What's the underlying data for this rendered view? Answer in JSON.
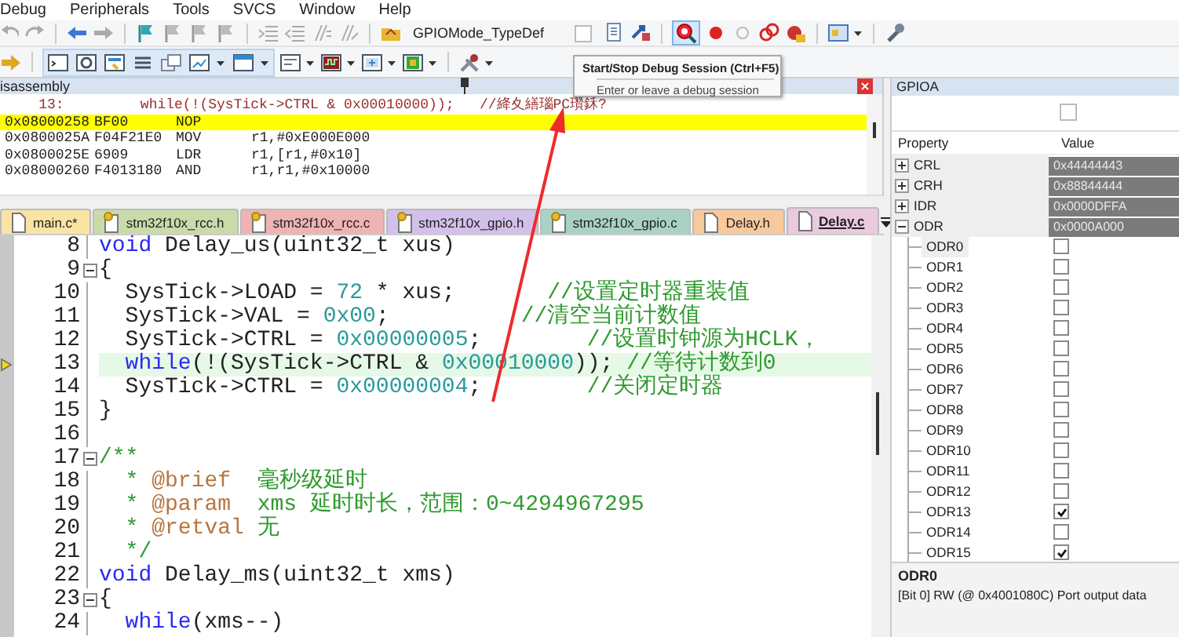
{
  "menu": [
    "Debug",
    "Peripherals",
    "Tools",
    "SVCS",
    "Window",
    "Help"
  ],
  "toolbar": {
    "symbol": "GPIOMode_TypeDef",
    "debug_button_highlighted": true
  },
  "tooltip": {
    "title": "Start/Stop Debug Session (Ctrl+F5)",
    "description": "Enter or leave a debug session"
  },
  "disassembly": {
    "title": "isassembly",
    "source": {
      "line": "13:",
      "code": "while(!(SysTick->CTRL & 0x00010000));   //絳夊繕瑙PC瓚鉌?"
    },
    "rows": [
      {
        "address": "0x08000258",
        "opcode": "BF00",
        "mnemonic": "NOP",
        "selected": true
      },
      {
        "address": "0x0800025A",
        "opcode": "F04F21E0",
        "mnemonic": "MOV",
        "operands": "r1,#0xE000E000",
        "selected": false
      },
      {
        "address": "0x0800025E",
        "opcode": "6909",
        "mnemonic": "LDR",
        "operands": "r1,[r1,#0x10]",
        "selected": false
      },
      {
        "address": "0x08000260",
        "opcode": "F4013180",
        "mnemonic": "AND",
        "operands": "r1,r1,#0x10000",
        "selected": false
      }
    ]
  },
  "editor": {
    "tabs": [
      {
        "label": "main.c*",
        "kind": "user",
        "color": "#f9e4a4",
        "selected": false
      },
      {
        "label": "stm32f10x_rcc.h",
        "kind": "library",
        "color": "#c9dba9",
        "selected": false
      },
      {
        "label": "stm32f10x_rcc.c",
        "kind": "library",
        "color": "#f0b3b3",
        "selected": false
      },
      {
        "label": "stm32f10x_gpio.h",
        "kind": "library",
        "color": "#d3c0ea",
        "selected": false
      },
      {
        "label": "stm32f10x_gpio.c",
        "kind": "library",
        "color": "#a9d2c5",
        "selected": false
      },
      {
        "label": "Delay.h",
        "kind": "user",
        "color": "#f7c99c",
        "selected": false
      },
      {
        "label": "Delay.c",
        "kind": "user",
        "color": "#e9cade",
        "selected": true
      }
    ],
    "lines": [
      {
        "number": "8",
        "fold": false,
        "current": false,
        "segments": [
          {
            "kind": "keyword",
            "text": "void"
          },
          {
            "kind": "plain",
            "text": " Delay_us(uint32_t xus)"
          }
        ]
      },
      {
        "number": "9",
        "fold": true,
        "current": false,
        "segments": [
          {
            "kind": "plain",
            "text": "{"
          }
        ]
      },
      {
        "number": "10",
        "fold": false,
        "current": false,
        "indented": true,
        "segments": [
          {
            "kind": "plain",
            "text": "SysTick->LOAD = "
          },
          {
            "kind": "number",
            "text": "72"
          },
          {
            "kind": "plain",
            "text": " * xus;       "
          },
          {
            "kind": "comment",
            "text": "//设置定时器重装值"
          }
        ]
      },
      {
        "number": "11",
        "fold": false,
        "current": false,
        "indented": true,
        "segments": [
          {
            "kind": "plain",
            "text": "SysTick->VAL = "
          },
          {
            "kind": "number",
            "text": "0x00"
          },
          {
            "kind": "plain",
            "text": ";          "
          },
          {
            "kind": "comment",
            "text": "//清空当前计数值"
          }
        ]
      },
      {
        "number": "12",
        "fold": false,
        "current": false,
        "indented": true,
        "segments": [
          {
            "kind": "plain",
            "text": "SysTick->CTRL = "
          },
          {
            "kind": "number",
            "text": "0x00000005"
          },
          {
            "kind": "plain",
            "text": ";        "
          },
          {
            "kind": "comment",
            "text": "//设置时钟源为HCLK，"
          }
        ]
      },
      {
        "number": "13",
        "fold": false,
        "current": true,
        "indented": true,
        "segments": [
          {
            "kind": "keyword",
            "text": "while"
          },
          {
            "kind": "plain",
            "text": "(!(SysTick->CTRL & "
          },
          {
            "kind": "number",
            "text": "0x00010000"
          },
          {
            "kind": "plain",
            "text": ")); "
          },
          {
            "kind": "comment",
            "text": "//等待计数到0"
          }
        ]
      },
      {
        "number": "14",
        "fold": false,
        "current": false,
        "indented": true,
        "segments": [
          {
            "kind": "plain",
            "text": "SysTick->CTRL = "
          },
          {
            "kind": "number",
            "text": "0x00000004"
          },
          {
            "kind": "plain",
            "text": ";        "
          },
          {
            "kind": "comment",
            "text": "//关闭定时器"
          }
        ]
      },
      {
        "number": "15",
        "fold": false,
        "current": false,
        "segments": [
          {
            "kind": "plain",
            "text": "}"
          }
        ]
      },
      {
        "number": "16",
        "fold": false,
        "current": false
      },
      {
        "number": "17",
        "fold": true,
        "current": false,
        "segments": [
          {
            "kind": "comment",
            "text": "/**"
          }
        ]
      },
      {
        "number": "18",
        "fold": false,
        "current": false,
        "indented": true,
        "segments": [
          {
            "kind": "comment",
            "text": "* "
          },
          {
            "kind": "tag",
            "text": "@brief"
          },
          {
            "kind": "comment",
            "text": "  毫秒级延时"
          }
        ]
      },
      {
        "number": "19",
        "fold": false,
        "current": false,
        "indented": true,
        "segments": [
          {
            "kind": "comment",
            "text": "* "
          },
          {
            "kind": "tag",
            "text": "@param"
          },
          {
            "kind": "comment",
            "text": "  xms 延时时长，范围：0~4294967295"
          }
        ]
      },
      {
        "number": "20",
        "fold": false,
        "current": false,
        "indented": true,
        "segments": [
          {
            "kind": "comment",
            "text": "* "
          },
          {
            "kind": "tag",
            "text": "@retval"
          },
          {
            "kind": "comment",
            "text": " 无"
          }
        ]
      },
      {
        "number": "21",
        "fold": false,
        "current": false,
        "indented": true,
        "segments": [
          {
            "kind": "comment",
            "text": "*/"
          }
        ]
      },
      {
        "number": "22",
        "fold": false,
        "current": false,
        "segments": [
          {
            "kind": "keyword",
            "text": "void"
          },
          {
            "kind": "plain",
            "text": " Delay_ms(uint32_t xms)"
          }
        ]
      },
      {
        "number": "23",
        "fold": true,
        "current": false,
        "segments": [
          {
            "kind": "plain",
            "text": "{"
          }
        ]
      },
      {
        "number": "24",
        "fold": false,
        "current": false,
        "indented": true,
        "segments": [
          {
            "kind": "keyword",
            "text": "while"
          },
          {
            "kind": "plain",
            "text": "(xms--)"
          }
        ]
      }
    ]
  },
  "peripheral": {
    "title": "GPIOA",
    "columns": [
      "Property",
      "Value"
    ],
    "registers": [
      {
        "name": "CRL",
        "value": "0x44444443",
        "expanded": false
      },
      {
        "name": "CRH",
        "value": "0x88844444",
        "expanded": false
      },
      {
        "name": "IDR",
        "value": "0x0000DFFA",
        "expanded": false
      },
      {
        "name": "ODR",
        "value": "0x0000A000",
        "expanded": true,
        "children": [
          {
            "name": "ODR0",
            "checked": false,
            "selected": true
          },
          {
            "name": "ODR1",
            "checked": false,
            "selected": false
          },
          {
            "name": "ODR2",
            "checked": false,
            "selected": false
          },
          {
            "name": "ODR3",
            "checked": false,
            "selected": false
          },
          {
            "name": "ODR4",
            "checked": false,
            "selected": false
          },
          {
            "name": "ODR5",
            "checked": false,
            "selected": false
          },
          {
            "name": "ODR6",
            "checked": false,
            "selected": false
          },
          {
            "name": "ODR7",
            "checked": false,
            "selected": false
          },
          {
            "name": "ODR8",
            "checked": false,
            "selected": false
          },
          {
            "name": "ODR9",
            "checked": false,
            "selected": false
          },
          {
            "name": "ODR10",
            "checked": false,
            "selected": false
          },
          {
            "name": "ODR11",
            "checked": false,
            "selected": false
          },
          {
            "name": "ODR12",
            "checked": false,
            "selected": false
          },
          {
            "name": "ODR13",
            "checked": true,
            "selected": false
          },
          {
            "name": "ODR14",
            "checked": false,
            "selected": false
          },
          {
            "name": "ODR15",
            "checked": true,
            "selected": false
          }
        ]
      }
    ],
    "description": {
      "title": "ODR0",
      "text": "[Bit 0] RW (@ 0x4001080C) Port output data"
    }
  }
}
